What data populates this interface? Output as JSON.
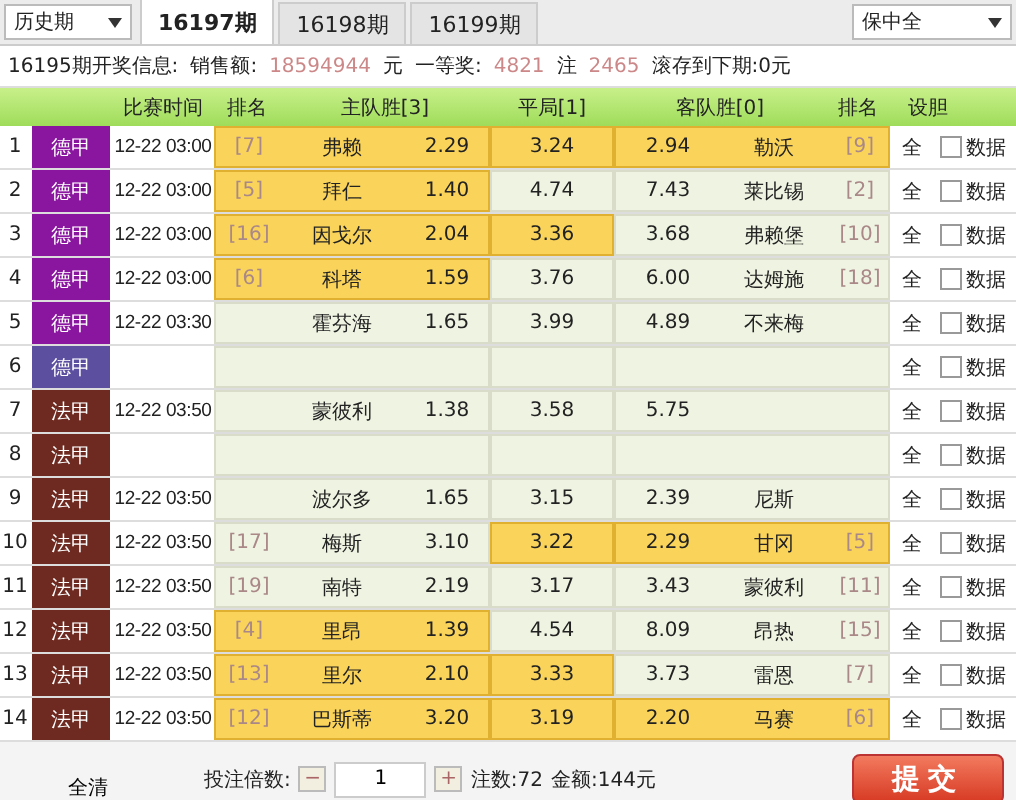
{
  "top_bar": {
    "history_dropdown": "历史期",
    "tabs": [
      {
        "label": "16197期",
        "selected": true
      },
      {
        "label": "16198期",
        "selected": false
      },
      {
        "label": "16199期",
        "selected": false
      }
    ],
    "mode_dropdown": "保中全"
  },
  "info": {
    "title": "16195期开奖信息:",
    "sales_label": "销售额:",
    "sales": "18594944",
    "sales_unit": "元",
    "prize_label": "一等奖:",
    "prize_count": "4821",
    "prize_unit": "注",
    "prize_amount": "2465",
    "rollover": "滚存到下期:0元"
  },
  "table": {
    "columns": [
      "比赛时间",
      "排名",
      "主队胜[3]",
      "平局[1]",
      "客队胜[0]",
      "排名",
      "设胆"
    ],
    "rows": [
      {
        "index": "1",
        "league": "德甲",
        "color": "#8a16a0",
        "time": "12-22 03:00",
        "home": {
          "rank": "[7]",
          "team": "弗赖",
          "odds": "2.29",
          "selected": true
        },
        "draw": {
          "odds": "3.24",
          "selected": true
        },
        "away": {
          "odds": "2.94",
          "team": "勒沃",
          "rank": "[9]",
          "selected": true
        },
        "all": "全",
        "checked": false,
        "data": "数据"
      },
      {
        "index": "2",
        "league": "德甲",
        "color": "#8a16a0",
        "time": "12-22 03:00",
        "home": {
          "rank": "[5]",
          "team": "拜仁",
          "odds": "1.40",
          "selected": true
        },
        "draw": {
          "odds": "4.74",
          "selected": false
        },
        "away": {
          "odds": "7.43",
          "team": "莱比锡",
          "rank": "[2]",
          "selected": false
        },
        "all": "全",
        "checked": false,
        "data": "数据"
      },
      {
        "index": "3",
        "league": "德甲",
        "color": "#8a16a0",
        "time": "12-22 03:00",
        "home": {
          "rank": "[16]",
          "team": "因戈尔",
          "odds": "2.04",
          "selected": true
        },
        "draw": {
          "odds": "3.36",
          "selected": true
        },
        "away": {
          "odds": "3.68",
          "team": "弗赖堡",
          "rank": "[10]",
          "selected": false
        },
        "all": "全",
        "checked": false,
        "data": "数据"
      },
      {
        "index": "4",
        "league": "德甲",
        "color": "#8a16a0",
        "time": "12-22 03:00",
        "home": {
          "rank": "[6]",
          "team": "科塔",
          "odds": "1.59",
          "selected": true
        },
        "draw": {
          "odds": "3.76",
          "selected": false
        },
        "away": {
          "odds": "6.00",
          "team": "达姆施",
          "rank": "[18]",
          "selected": false
        },
        "all": "全",
        "checked": false,
        "data": "数据"
      },
      {
        "index": "5",
        "league": "德甲",
        "color": "#8a16a0",
        "time": "12-22 03:30",
        "home": {
          "team": "霍芬海",
          "odds": "1.65",
          "selected": false
        },
        "draw": {
          "odds": "3.99",
          "selected": false
        },
        "away": {
          "odds": "4.89",
          "team": "不来梅",
          "selected": false
        },
        "all": "全",
        "checked": false,
        "data": "数据"
      },
      {
        "index": "6",
        "league": "德甲",
        "color": "#5c4fa0",
        "draw": {
          "selected": false
        },
        "home": {
          "selected": false
        },
        "away": {
          "selected": false
        },
        "all": "全",
        "checked": false,
        "data": "数据"
      },
      {
        "index": "7",
        "league": "法甲",
        "color": "#6e2a20",
        "time": "12-22 03:50",
        "home": {
          "team": "蒙彼利",
          "odds": "1.38",
          "selected": false
        },
        "draw": {
          "odds": "3.58",
          "selected": false
        },
        "away": {
          "odds": "5.75",
          "selected": false
        },
        "all": "全",
        "checked": false,
        "data": "数据"
      },
      {
        "index": "8",
        "league": "法甲",
        "color": "#6e2a20",
        "home": {
          "selected": false
        },
        "draw": {
          "selected": false
        },
        "away": {
          "selected": false
        },
        "all": "全",
        "checked": false,
        "data": "数据"
      },
      {
        "index": "9",
        "league": "法甲",
        "color": "#6e2a20",
        "time": "12-22 03:50",
        "home": {
          "team": "波尔多",
          "odds": "1.65",
          "selected": false
        },
        "draw": {
          "odds": "3.15",
          "selected": false
        },
        "away": {
          "odds": "2.39",
          "team": "尼斯",
          "selected": false
        },
        "all": "全",
        "checked": false,
        "data": "数据"
      },
      {
        "index": "10",
        "league": "法甲",
        "color": "#6e2a20",
        "time": "12-22 03:50",
        "home": {
          "rank": "[17]",
          "team": "梅斯",
          "odds": "3.10",
          "selected": false
        },
        "draw": {
          "odds": "3.22",
          "selected": true
        },
        "away": {
          "odds": "2.29",
          "team": "甘冈",
          "rank": "[5]",
          "selected": true
        },
        "all": "全",
        "checked": false,
        "data": "数据"
      },
      {
        "index": "11",
        "league": "法甲",
        "color": "#6e2a20",
        "time": "12-22 03:50",
        "home": {
          "rank": "[19]",
          "team": "南特",
          "odds": "2.19",
          "selected": false
        },
        "draw": {
          "odds": "3.17",
          "selected": false
        },
        "away": {
          "odds": "3.43",
          "team": "蒙彼利",
          "rank": "[11]",
          "selected": false
        },
        "all": "全",
        "checked": false,
        "data": "数据"
      },
      {
        "index": "12",
        "league": "法甲",
        "color": "#6e2a20",
        "time": "12-22 03:50",
        "home": {
          "rank": "[4]",
          "team": "里昂",
          "odds": "1.39",
          "selected": true
        },
        "draw": {
          "odds": "4.54",
          "selected": false
        },
        "away": {
          "odds": "8.09",
          "team": "昂热",
          "rank": "[15]",
          "selected": false
        },
        "all": "全",
        "checked": false,
        "data": "数据"
      },
      {
        "index": "13",
        "league": "法甲",
        "color": "#6e2a20",
        "time": "12-22 03:50",
        "home": {
          "rank": "[13]",
          "team": "里尔",
          "odds": "2.10",
          "selected": true
        },
        "draw": {
          "odds": "3.33",
          "selected": true
        },
        "away": {
          "odds": "3.73",
          "team": "雷恩",
          "rank": "[7]",
          "selected": false
        },
        "all": "全",
        "checked": false,
        "data": "数据"
      },
      {
        "index": "14",
        "league": "法甲",
        "color": "#6e2a20",
        "time": "12-22 03:50",
        "home": {
          "rank": "[12]",
          "team": "巴斯蒂",
          "odds": "3.20",
          "selected": true
        },
        "draw": {
          "odds": "3.19",
          "selected": true
        },
        "away": {
          "odds": "2.20",
          "team": "马赛",
          "rank": "[6]",
          "selected": true
        },
        "all": "全",
        "checked": false,
        "data": "数据"
      }
    ]
  },
  "footer": {
    "clear_button": "全清",
    "multiplier_label": "投注倍数:",
    "minus": "−",
    "multiplier": "1",
    "plus": "+",
    "count": "注数:72",
    "amount": "金额:144元",
    "submit_button": "提交"
  }
}
